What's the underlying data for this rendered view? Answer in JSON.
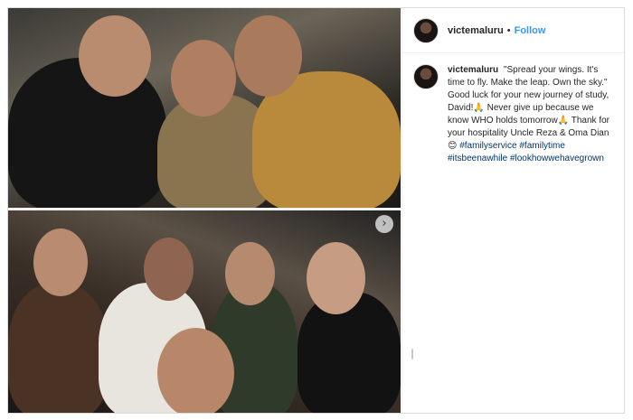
{
  "post": {
    "username": "victemaluru",
    "separator": "•",
    "follow_label": "Follow",
    "caption": {
      "username": "victemaluru",
      "line1": "\"Spread your wings. It's time to fly. Make the leap. Own the sky.\" Good luck for your new journey of study, David!",
      "emoji_pray_1": "🙏",
      "line2": "Never give up because we know WHO holds tomorrow",
      "emoji_pray_2": "🙏",
      "line3": "Thank for your hospitality Uncle Reza & Oma Dian",
      "emoji_smile": "😊",
      "tags": [
        "#familyservice",
        "#familytime",
        "#itsbeenawhile",
        "#lookhowwehavegrown"
      ]
    },
    "carousel": {
      "next_icon": "›"
    }
  }
}
